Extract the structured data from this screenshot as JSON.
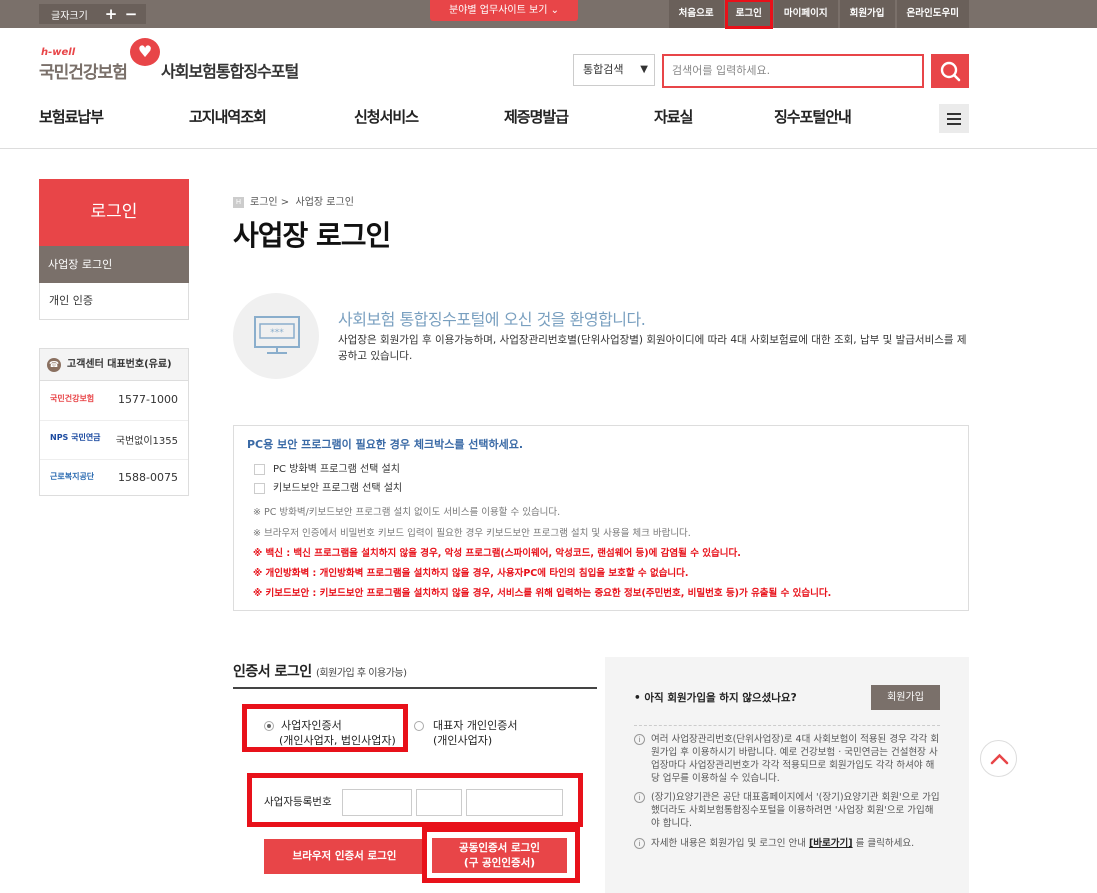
{
  "topbar": {
    "font_size_label": "글자크기",
    "plus": "+",
    "minus": "−",
    "mobile_site": "분야별 업무사이트 보기",
    "links": [
      "처음으로",
      "로그인",
      "마이페이지",
      "회원가입",
      "온라인도우미"
    ]
  },
  "header": {
    "logo_hwell": "h-well",
    "logo_org": "국민건강보험",
    "portal_name": "사회보험통합징수포털",
    "search_select": "통합검색",
    "search_placeholder": "검색어를 입력하세요."
  },
  "gnb": [
    "보험료납부",
    "고지내역조회",
    "신청서비스",
    "제증명발급",
    "자료실",
    "징수포털안내"
  ],
  "lnb": {
    "title": "로그인",
    "items": [
      "사업장 로그인",
      "개인 인증"
    ]
  },
  "customer_center": {
    "title": "고객센터 대표번호(유료)",
    "rows": [
      {
        "org": "국민건강보험",
        "number": "1577-1000"
      },
      {
        "org": "NPS 국민연금",
        "number": "국번없이1355"
      },
      {
        "org": "근로복지공단",
        "number": "1588-0075"
      }
    ]
  },
  "breadcrumb": [
    "로그인",
    "사업장 로그인"
  ],
  "page_title": "사업장 로그인",
  "welcome": {
    "title": "사회보험 통합징수포털에 오신 것을 환영합니다.",
    "desc": "사업장은 회원가입 후 이용가능하며, 사업장관리번호별(단위사업장별) 회원아이디에 따라 4대 사회보험료에 대한 조회, 납부 및 발급서비스를 제공하고 있습니다."
  },
  "security": {
    "title": "PC용 보안 프로그램이 필요한 경우 체크박스를 선택하세요.",
    "checkboxes": [
      "PC 방화벽 프로그램 선택 설치",
      "키보드보안 프로그램 선택 설치"
    ],
    "notes": [
      "※ PC 방화벽/키보드보안 프로그램 설치 없이도 서비스를 이용할 수 있습니다.",
      "※ 브라우저 인증에서 비밀번호 키보드 입력이 필요한 경우 키보드보안 프로그램 설치 및 사용을 체크 바랍니다."
    ],
    "warnings": [
      "※ 백신 : 백신 프로그램을 설치하지 않을 경우, 악성 프로그램(스파이웨어, 악성코드, 랜섬웨어 등)에 감염될 수 있습니다.",
      "※ 개인방화벽 : 개인방화벽 프로그램을 설치하지 않을 경우, 사용자PC에 타인의 침입을 보호할 수 없습니다.",
      "※ 키보드보안 : 키보드보안 프로그램을 설치하지 않을 경우, 서비스를 위해 입력하는 중요한 정보(주민번호, 비밀번호 등)가 유출될 수 있습니다."
    ]
  },
  "cert_login": {
    "title": "인증서 로그인",
    "subtitle": "(회원가입 후 이용가능)",
    "option1_line1": "사업자인증서",
    "option1_line2": "(개인사업자, 법인사업자)",
    "option2_line1": "대표자 개인인증서",
    "option2_line2": "(개인사업자)",
    "bizno_label": "사업자등록번호",
    "browser_btn": "브라우저 인증서 로그인",
    "joint_btn_line1": "공동인증서 로그인",
    "joint_btn_line2": "(구 공인인증서)"
  },
  "side_panel": {
    "question": "• 아직 회원가입을 하지 않으셨나요?",
    "join_btn": "회원가입",
    "items": [
      "여러 사업장관리번호(단위사업장)로 4대 사회보험이 적용된 경우 각각 회원가입 후 이용하시기 바랍니다. 예로 건강보험 · 국민연금는 건설현장 사업장마다 사업장관리번호가 각각 적용되므로 회원가입도 각각 하셔야 해당 업무를 이용하실 수 있습니다.",
      "(장기)요양기관은 공단 대표홈페이지에서 '(장기)요양기관 회원'으로 가입했더라도 사회보험통합징수포털을 이용하려면 '사업장 회원'으로 가입해야 합니다."
    ],
    "item3_pre": "자세한 내용은 회원가입 및 로그인 안내 ",
    "item3_link": "[바로가기]",
    "item3_post": " 를 클릭하세요."
  },
  "colors": {
    "accent": "#e84548",
    "brown": "#7a706a",
    "highlight": "#e8111a"
  }
}
